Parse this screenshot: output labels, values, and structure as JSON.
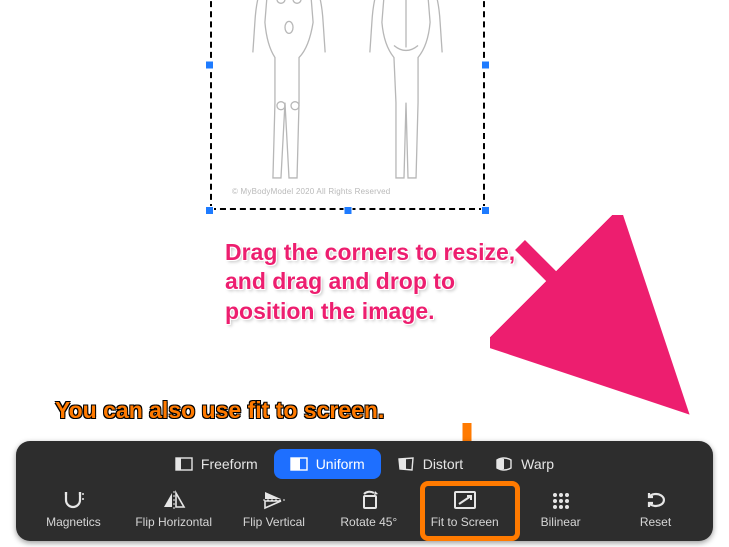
{
  "watermark": "© MyBodyModel 2020 All Rights Reserved",
  "callouts": {
    "drag_resize": "Drag the corners to resize, and drag and drop to position the image.",
    "fit_to_screen": "You can also use fit to screen."
  },
  "modes": {
    "freeform": "Freeform",
    "uniform": "Uniform",
    "distort": "Distort",
    "warp": "Warp"
  },
  "tools": {
    "magnetics": "Magnetics",
    "flip_horizontal": "Flip Horizontal",
    "flip_vertical": "Flip Vertical",
    "rotate_45": "Rotate 45°",
    "fit_to_screen": "Fit to Screen",
    "bilinear": "Bilinear",
    "reset": "Reset"
  },
  "colors": {
    "accent_pink": "#ed1e6f",
    "accent_orange": "#ff7a00",
    "accent_blue": "#1e6fff",
    "toolbar_bg": "#2d2d2d"
  }
}
